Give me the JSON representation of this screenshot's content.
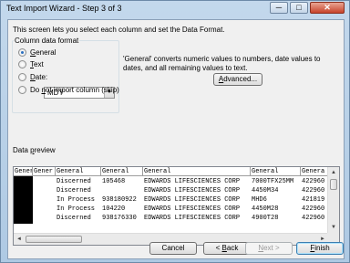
{
  "window": {
    "title": "Text Import Wizard - Step 3 of 3",
    "minimize_glyph": "─",
    "maximize_glyph": "□",
    "close_glyph": "✕"
  },
  "intro_text": "This screen lets you select each column and set the Data Format.",
  "column_format": {
    "title": "Column data format",
    "options": [
      {
        "key": "G",
        "rest": "eneral",
        "checked": true
      },
      {
        "key": "T",
        "rest": "ext",
        "checked": false
      },
      {
        "key": "D",
        "rest": "ate:",
        "checked": false
      },
      {
        "pre": "Do ",
        "key": "n",
        "rest": "ot import column (skip)",
        "checked": false
      }
    ],
    "date_format": "MDY",
    "dropdown_glyph": "▼"
  },
  "description": "'General' converts numeric values to numbers, date values to dates, and all remaining values to text.",
  "advanced_button": {
    "key": "A",
    "rest": "dvanced..."
  },
  "preview": {
    "label_pre": "Data ",
    "label_key": "p",
    "label_rest": "review",
    "headers": [
      "Gener",
      "Gener",
      "General",
      "General",
      "General",
      "General",
      "Genera"
    ],
    "rows": [
      [
        "",
        "",
        "Discerned",
        "105468",
        "EDWARDS LIFESCIENCES CORP",
        "7000TFX25MM",
        "422960"
      ],
      [
        "",
        "",
        "Discerned",
        "",
        "EDWARDS LIFESCIENCES CORP",
        "4450M34",
        "422960"
      ],
      [
        "",
        "",
        "In Process",
        "938180922",
        "EDWARDS LIFESCIENCES CORP",
        "MHD6",
        "421819"
      ],
      [
        "",
        "",
        "In Process",
        "104220",
        "EDWARDS LIFESCIENCES CORP",
        "4450M28",
        "422960"
      ],
      [
        "",
        "",
        "Discerned",
        "938176330",
        "EDWARDS LIFESCIENCES CORP",
        "4900T28",
        "422960"
      ]
    ],
    "scroll_up": "▲",
    "scroll_down": "▼",
    "scroll_left": "◄",
    "scroll_right": "►"
  },
  "footer": {
    "cancel": "Cancel",
    "back_pre": "< ",
    "back_key": "B",
    "back_rest": "ack",
    "next_pre": "",
    "next_key": "N",
    "next_rest": "ext >",
    "finish_key": "F",
    "finish_rest": "inish"
  }
}
